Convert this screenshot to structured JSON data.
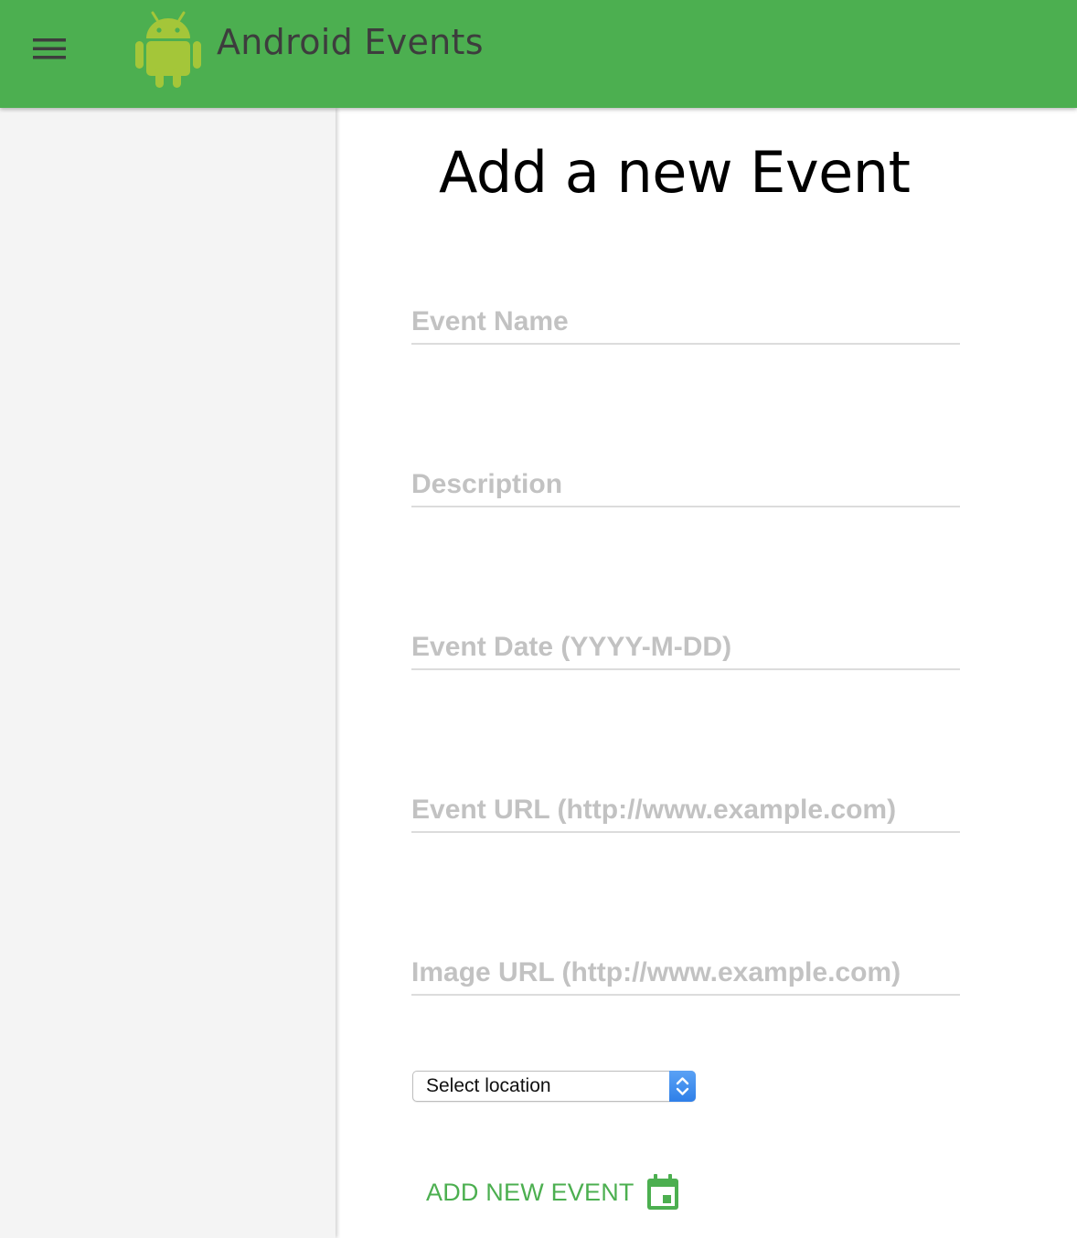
{
  "app": {
    "title": "Android Events",
    "brand_color": "#4caf50",
    "logo_color": "#a4c639"
  },
  "header": {
    "menu_icon": "hamburger-menu-icon",
    "logo_icon": "android-robot-icon"
  },
  "main": {
    "page_title": "Add a new Event",
    "fields": {
      "event_name": {
        "placeholder": "Event Name",
        "value": ""
      },
      "description": {
        "placeholder": "Description",
        "value": ""
      },
      "event_date": {
        "placeholder": "Event Date (YYYY-M-DD)",
        "value": ""
      },
      "event_url": {
        "placeholder": "Event URL (http://www.example.com)",
        "value": ""
      },
      "image_url": {
        "placeholder": "Image URL (http://www.example.com)",
        "value": ""
      }
    },
    "location_select": {
      "selected": "Select location",
      "icon": "select-up-down-arrows-icon"
    },
    "add_button": {
      "label": "ADD NEW EVENT",
      "icon": "calendar-event-icon"
    }
  }
}
